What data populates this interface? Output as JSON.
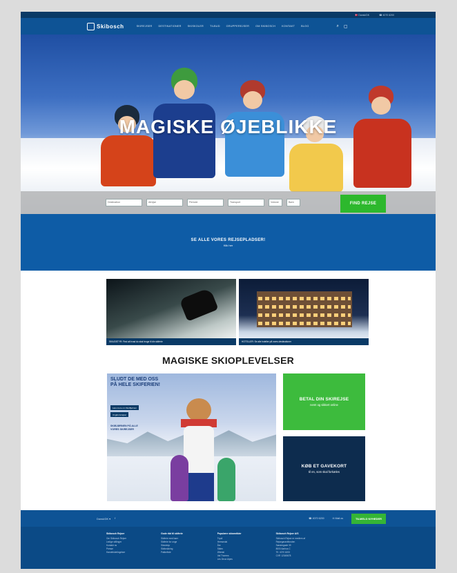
{
  "topbar": {
    "language": "🇩🇰 Dansk/DK",
    "phone": "☎ 4070 6200"
  },
  "nav": {
    "logo_text": "Skibosch",
    "menu": [
      "Skirejser",
      "Destinationer",
      "Skiskoler",
      "Tilbud",
      "Grupperejser",
      "Om Skibosch",
      "Kontakt",
      "Blog"
    ],
    "icons": [
      "search-icon",
      "cart-icon"
    ]
  },
  "hero": {
    "title": "MAGISKE ØJEBLIKKE",
    "search_fields": [
      "Destination",
      "Afrejse",
      "Periode",
      "Transport",
      "Voksne",
      "Børn"
    ],
    "find_button": "FIND REJSE"
  },
  "banner": {
    "line1": "SE ALLE VORES REJSEPLADSER!",
    "line2": "Klik her"
  },
  "cards": [
    {
      "caption": "SKIUDSTYR: Find alt hvad du skal bruge til din skiferie"
    },
    {
      "caption": "HOTELLER: Se alle hoteller på vores destinationer"
    }
  ],
  "section_title": "MAGISKE SKIOPLEVELSER",
  "promo": {
    "heading": "SLUDT DE MED OSS PÅ HELE SKIFERIEN!",
    "pill1": "Læs mere om Ski-Bjørnen",
    "pill2": "Ungdomsrejser",
    "sub": "SKIBJØRNEN PÅ ALLE VORES SKIREJSER"
  },
  "tiles": [
    {
      "title": "BETAL DIN SKIREJSE",
      "sub": "nemt og sikkert online",
      "color": "#3dbb3d"
    },
    {
      "title": "KØB ET GAVEKORT",
      "sub": "til en, som skal forkæles",
      "color": "#0d2c4e"
    }
  ],
  "footer": {
    "language": "Dansk/DK ▾",
    "social_icon": "facebook-icon",
    "phone": "☎ 4070 6200",
    "email": "✉ Mail os",
    "signup": "TILMELD NYHEDER",
    "columns": [
      {
        "heading": "Skibosch Rejser",
        "items": [
          "Om Skibosch Rejser",
          "Ledige stillinger",
          "Kontakt os",
          "Presse",
          "Handelsbetingelser"
        ]
      },
      {
        "heading": "Gode råd til skiferie",
        "items": [
          "Skiferie med børn",
          "Skiferie for unge",
          "Skiudstyr",
          "Skiforsikring",
          "Pakkeliste"
        ]
      },
      {
        "heading": "Populære skiområder",
        "items": [
          "Trysil",
          "Hemsedal",
          "Åre",
          "Sälen",
          "Zillertal",
          "Val Thorens",
          "Les Deux Alpes"
        ]
      },
      {
        "heading": "Skibosch Rejser A/S",
        "items": [
          "Skibosch Rejser er medlem af",
          "Rejsegarantifonden",
          "Søndergade 39",
          "8000 Aarhus C",
          "Tlf. 4070 6200",
          "CVR 12345678"
        ]
      }
    ]
  }
}
